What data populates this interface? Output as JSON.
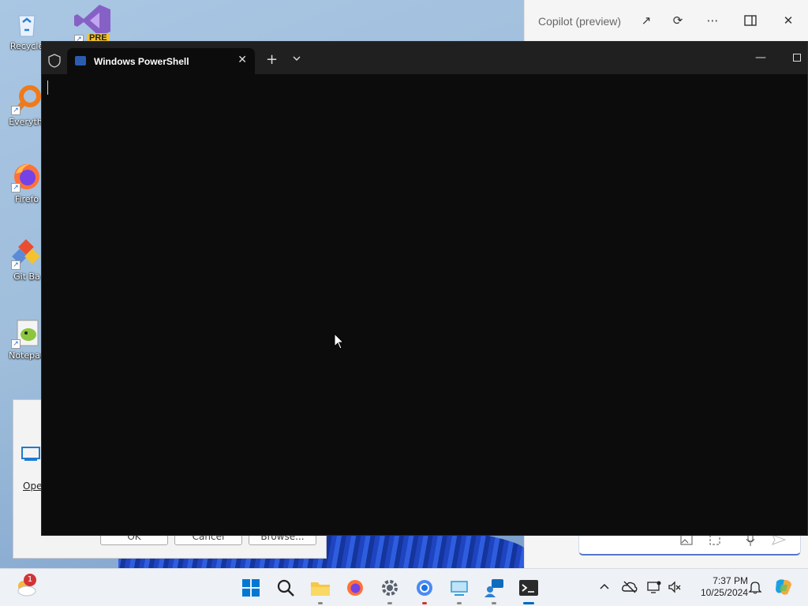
{
  "desktop": {
    "icons": [
      {
        "label": "Recycle",
        "icon": "recycle-bin-icon"
      },
      {
        "label": "Everythi",
        "icon": "everything-search-icon"
      },
      {
        "label": "Firefo",
        "icon": "firefox-icon"
      },
      {
        "label": "Git Ba",
        "icon": "git-bash-icon"
      },
      {
        "label": "Notepac",
        "icon": "notepad-plus-plus-icon"
      }
    ],
    "vs_badge": "PRE"
  },
  "run_dialog": {
    "open_label": "Oper",
    "buttons": [
      "OK",
      "Cancel",
      "Browse..."
    ]
  },
  "copilot": {
    "title": "Copilot (preview)"
  },
  "terminal": {
    "tab_title": "Windows PowerShell"
  },
  "taskbar": {
    "weather_badge": "1",
    "apps": [
      {
        "name": "start",
        "icon": "windows-start-icon"
      },
      {
        "name": "search",
        "icon": "search-icon"
      },
      {
        "name": "file-explorer",
        "icon": "folder-icon"
      },
      {
        "name": "firefox",
        "icon": "firefox-icon"
      },
      {
        "name": "settings",
        "icon": "gear-icon"
      },
      {
        "name": "chrome",
        "icon": "chrome-icon"
      },
      {
        "name": "remote-desktop",
        "icon": "monitor-icon"
      },
      {
        "name": "feedback",
        "icon": "people-chat-icon"
      },
      {
        "name": "terminal",
        "icon": "terminal-icon"
      }
    ],
    "time": "7:37 PM",
    "date": "10/25/2024"
  }
}
